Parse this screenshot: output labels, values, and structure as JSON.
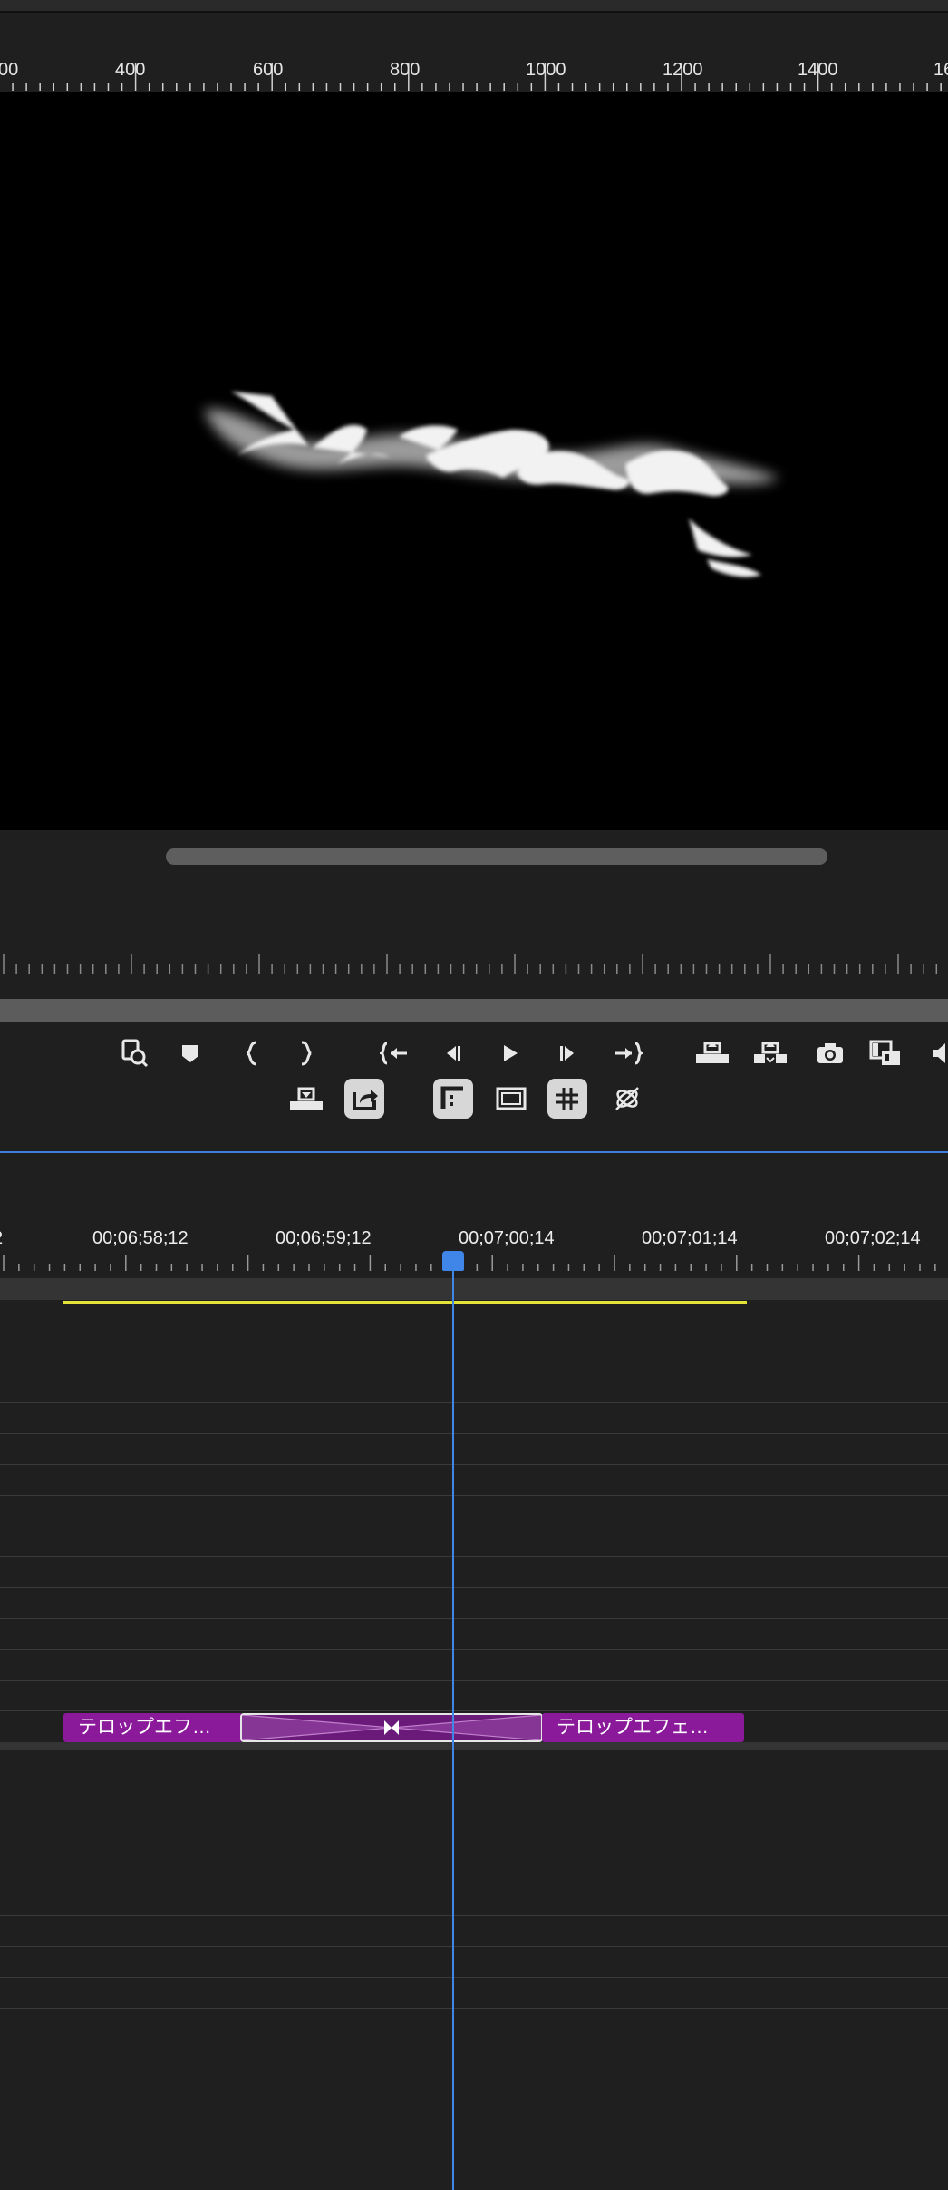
{
  "ruler": {
    "labels": [
      "00",
      "400",
      "600",
      "800",
      "1000",
      "1200",
      "1400",
      "16"
    ]
  },
  "viewer": {
    "overlay_text": ""
  },
  "transport": {
    "row1": [
      "find-icon",
      "marker-icon",
      "mark-in-icon",
      "mark-out-icon",
      "go-to-in-icon",
      "step-back-icon",
      "play-icon",
      "step-forward-icon",
      "go-to-out-icon",
      "lift-icon",
      "extract-icon",
      "camera-icon",
      "compare-icon",
      "volume-icon"
    ],
    "row2": [
      "insert-icon",
      "export-icon",
      "safe-margins-icon",
      "frame-icon",
      "grid-icon",
      "vr-toggle-icon"
    ]
  },
  "timeline": {
    "timecodes": [
      "2",
      "00;06;58;12",
      "00;06;59;12",
      "00;07;00;14",
      "00;07;01;14",
      "00;07;02;14"
    ],
    "clips": [
      {
        "label": "テロップエフ…"
      },
      {
        "label": "テロップエフェ…"
      }
    ]
  },
  "colors": {
    "accent": "#3f86e8",
    "clip": "#8a1a9a",
    "workarea": "#e2e238"
  }
}
